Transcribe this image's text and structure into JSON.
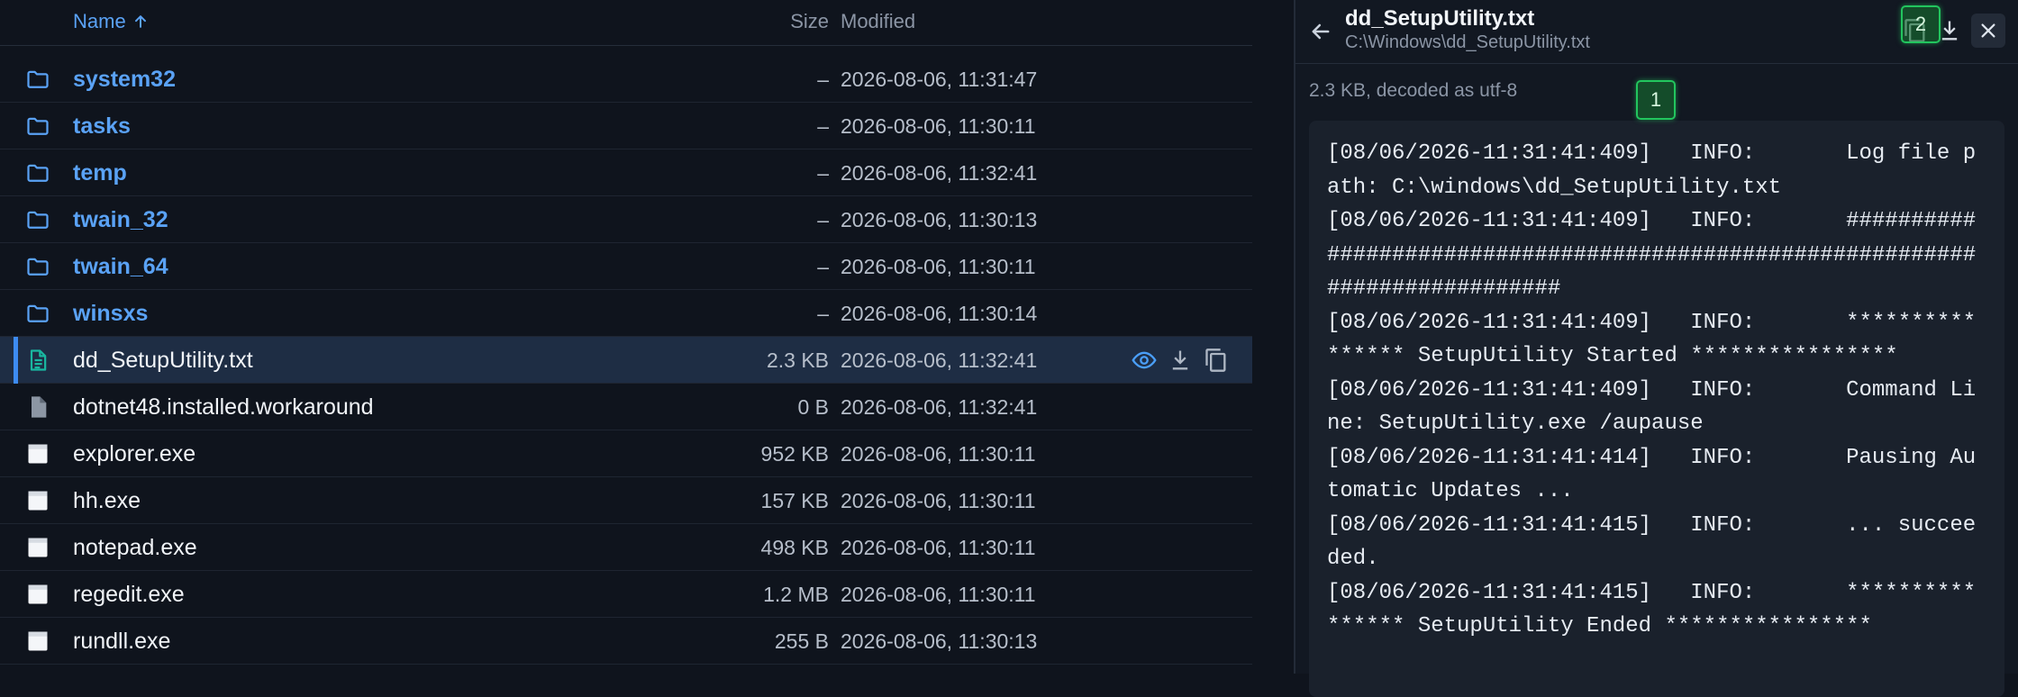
{
  "list_header": {
    "name": "Name",
    "size": "Size",
    "modified": "Modified"
  },
  "rows": [
    {
      "name": "system32",
      "size": "–",
      "modified": "2026-08-06, 11:31:47",
      "kind": "folder"
    },
    {
      "name": "tasks",
      "size": "–",
      "modified": "2026-08-06, 11:30:11",
      "kind": "folder"
    },
    {
      "name": "temp",
      "size": "–",
      "modified": "2026-08-06, 11:32:41",
      "kind": "folder"
    },
    {
      "name": "twain_32",
      "size": "–",
      "modified": "2026-08-06, 11:30:13",
      "kind": "folder"
    },
    {
      "name": "twain_64",
      "size": "–",
      "modified": "2026-08-06, 11:30:11",
      "kind": "folder"
    },
    {
      "name": "winsxs",
      "size": "–",
      "modified": "2026-08-06, 11:30:14",
      "kind": "folder"
    },
    {
      "name": "dd_SetupUtility.txt",
      "size": "2.3 KB",
      "modified": "2026-08-06, 11:32:41",
      "kind": "text",
      "selected": true
    },
    {
      "name": "dotnet48.installed.workaround",
      "size": "0 B",
      "modified": "2026-08-06, 11:32:41",
      "kind": "file"
    },
    {
      "name": "explorer.exe",
      "size": "952 KB",
      "modified": "2026-08-06, 11:30:11",
      "kind": "exe"
    },
    {
      "name": "hh.exe",
      "size": "157 KB",
      "modified": "2026-08-06, 11:30:11",
      "kind": "exe"
    },
    {
      "name": "notepad.exe",
      "size": "498 KB",
      "modified": "2026-08-06, 11:30:11",
      "kind": "exe"
    },
    {
      "name": "regedit.exe",
      "size": "1.2 MB",
      "modified": "2026-08-06, 11:30:11",
      "kind": "exe"
    },
    {
      "name": "rundll.exe",
      "size": "255 B",
      "modified": "2026-08-06, 11:30:13",
      "kind": "exe"
    }
  ],
  "preview": {
    "title": "dd_SetupUtility.txt",
    "path": "C:\\Windows\\dd_SetupUtility.txt",
    "meta": "2.3 KB, decoded as utf-8",
    "content": "[08/06/2026-11:31:41:409]   INFO:       Log file path: C:\\windows\\dd_SetupUtility.txt\n[08/06/2026-11:31:41:409]   INFO:       ##############################################################################\n[08/06/2026-11:31:41:409]   INFO:       **************** SetupUtility Started ****************\n[08/06/2026-11:31:41:409]   INFO:       Command Line: SetupUtility.exe /aupause\n[08/06/2026-11:31:41:414]   INFO:       Pausing Automatic Updates ...\n[08/06/2026-11:31:41:415]   INFO:       ... succeeded.\n[08/06/2026-11:31:41:415]   INFO:       **************** SetupUtility Ended ****************"
  },
  "markers": {
    "m1": "1",
    "m2": "2"
  },
  "colors": {
    "accent": "#5aa2f5",
    "selected_row": "#1e2d44",
    "marker": "#22c55e"
  }
}
